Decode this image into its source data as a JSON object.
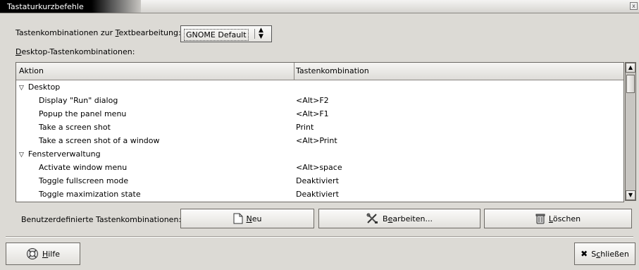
{
  "window": {
    "title": "Tastaturkurzbefehle",
    "close_glyph": "x"
  },
  "text_editing": {
    "label_pre": "Tastenkombinationen zur ",
    "label_mnemonic": "T",
    "label_post": "extbearbeitung:",
    "selected": "GNOME Default",
    "arrow": "⬍"
  },
  "desktop_shortcuts_label": {
    "mnemonic": "D",
    "rest": "esktop-Tastenkombinationen:"
  },
  "tree": {
    "columns": [
      "Aktion",
      "Tastenkombination"
    ],
    "rows": [
      {
        "action": "Desktop",
        "key": "",
        "group": true
      },
      {
        "action": "Display \"Run\" dialog",
        "key": "<Alt>F2"
      },
      {
        "action": "Popup the panel menu",
        "key": "<Alt>F1"
      },
      {
        "action": "Take a screen shot",
        "key": "Print"
      },
      {
        "action": "Take a screen shot of a window",
        "key": "<Alt>Print"
      },
      {
        "action": "Fensterverwaltung",
        "key": "",
        "group": true
      },
      {
        "action": "Activate window menu",
        "key": "<Alt>space"
      },
      {
        "action": "Toggle fullscreen mode",
        "key": "Deaktiviert"
      },
      {
        "action": "Toggle maximization state",
        "key": "Deaktiviert"
      }
    ],
    "expander_glyph": "▽"
  },
  "scrollbar": {
    "up": "▲",
    "down": "▼"
  },
  "custom": {
    "label": "Benutzerdefinierte Tastenkombinationen:",
    "new": {
      "mnemonic": "N",
      "rest": "eu"
    },
    "edit": {
      "pre": "B",
      "mnemonic": "e",
      "rest": "arbeiten..."
    },
    "delete": {
      "mnemonic": "L",
      "rest": "öschen"
    }
  },
  "footer": {
    "help": {
      "mnemonic": "H",
      "rest": "ilfe"
    },
    "close": {
      "pre": "S",
      "mnemonic": "c",
      "rest": "hließen",
      "glyph": "✖"
    }
  }
}
